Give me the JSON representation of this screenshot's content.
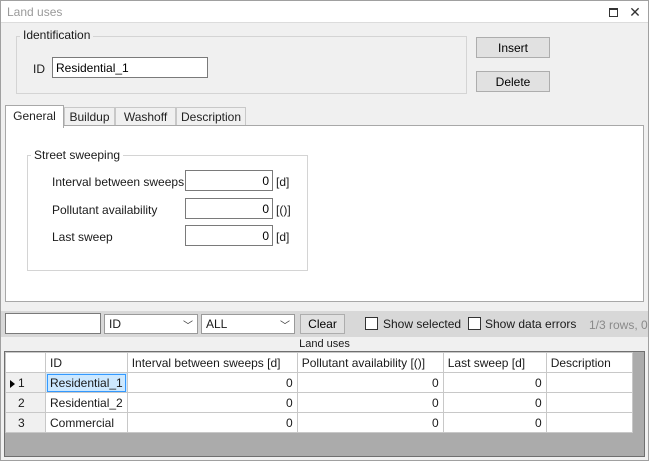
{
  "window": {
    "title": "Land uses"
  },
  "identification": {
    "legend": "Identification",
    "id_label": "ID",
    "id_value": "Residential_1",
    "insert_label": "Insert",
    "delete_label": "Delete"
  },
  "tabs": [
    {
      "label": "General",
      "active": true
    },
    {
      "label": "Buildup",
      "active": false
    },
    {
      "label": "Washoff",
      "active": false
    },
    {
      "label": "Description",
      "active": false
    }
  ],
  "street_sweeping": {
    "legend": "Street sweeping",
    "fields": [
      {
        "label": "Interval between sweeps",
        "value": "0",
        "unit": "[d]"
      },
      {
        "label": "Pollutant availability",
        "value": "0",
        "unit": "[()]"
      },
      {
        "label": "Last sweep",
        "value": "0",
        "unit": "[d]"
      }
    ]
  },
  "filter_bar": {
    "search_value": "",
    "column_select": "ID",
    "condition_select": "ALL",
    "clear_label": "Clear",
    "show_selected_label": "Show selected",
    "show_selected_checked": false,
    "show_errors_label": "Show data errors",
    "show_errors_checked": false,
    "row_count": "1/3 rows, 0"
  },
  "grid": {
    "title": "Land uses",
    "columns": [
      "",
      "ID",
      "Interval between sweeps [d]",
      "Pollutant availability [()]",
      "Last sweep [d]",
      "Description"
    ],
    "rows": [
      {
        "num": "1",
        "id": "Residential_1",
        "interval": "0",
        "availability": "0",
        "last_sweep": "0",
        "description": "",
        "current": true
      },
      {
        "num": "2",
        "id": "Residential_2",
        "interval": "0",
        "availability": "0",
        "last_sweep": "0",
        "description": "",
        "current": false
      },
      {
        "num": "3",
        "id": "Commercial",
        "interval": "0",
        "availability": "0",
        "last_sweep": "0",
        "description": "",
        "current": false
      }
    ]
  }
}
